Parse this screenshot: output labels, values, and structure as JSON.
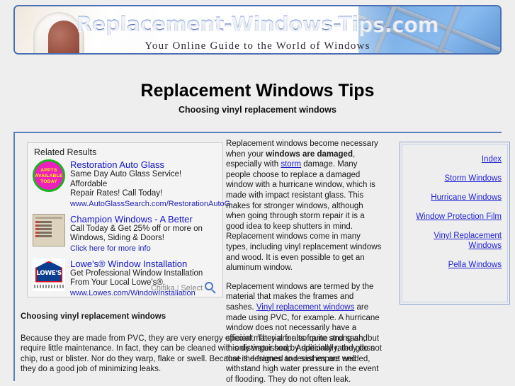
{
  "banner": {
    "title": "Replacement-Windows-Tips.com",
    "tagline": "Your Online Guide to the World of Windows",
    "border_color": "#4a6fb5"
  },
  "page": {
    "title": "Replacement Windows Tips",
    "subtitle": "Choosing vinyl replacement windows",
    "background": "#eeeeee"
  },
  "ads": {
    "heading": "Related Results",
    "items": [
      {
        "thumb": "appts-available-today-badge",
        "badge_line1": "APPTS",
        "badge_line2": "AVAILABLE",
        "badge_line3": "TODAY",
        "title": "Restoration Auto Glass",
        "desc_line1": "Same Day Auto Glass Service! Affordable",
        "desc_line2": "Repair Rates! Call Today!",
        "url": "www.AutoGlassSearch.com/RestorationAutoG"
      },
      {
        "thumb": "form-list-thumbnail",
        "title": "Champion Windows - A Better",
        "desc_line1": "Call Today & Get 25% off or more on",
        "desc_line2": "Windows, Siding & Doors!",
        "url": "Click here for more info"
      },
      {
        "thumb": "lowes-logo",
        "logo_text": "LOWE'S",
        "title": "Lowe's® Window Installation",
        "desc_line1": "Get Professional Window Installation",
        "desc_line2": "From Your Local Lowe's®.",
        "url": "www.Lowes.com/WindowInstallation"
      }
    ],
    "footer": {
      "brand": "Chitika",
      "separator": "|",
      "select": "Select",
      "icon": "magnifier-icon"
    }
  },
  "article": {
    "p1_a": "Replacement windows become necessary when your ",
    "p1_bold": "windows are damaged",
    "p1_b": ", especially with ",
    "p1_link": "storm",
    "p1_c": " damage. Many people choose to replace a damaged window with a hurricane window, which is made with impact resistant glass. This makes for stronger windows, although when going through storm repair it is a good idea to keep shutters in mind. Replacement windows come in many types, including vinyl replacement windows and wood. It is even possible to get an aluminum window.",
    "p2_a": "Replacement windows are termed by the material that makes the frames and sashes. ",
    "p2_link": "Vinyl replacement windows",
    "p2_b": " are made using PVC, for example. A hurricane window does not necessarily have a special material for its frame and sash, but it is distinguished by specially rated glass that is designed to resist impact and withstand high water pressure in the event of flooding. They do not often leak.",
    "subheading": "Choosing vinyl replacement windows",
    "p3": "Because they are made from PVC, they are very energy efficient. They are also quite strong and require little maintenance. In fact, they can be cleaned with only water soap. Additionally, they do not chip, rust or blister. Nor do they warp, flake or swell. Because the frames and sashes are welded, they do a good job of minimizing leaks."
  },
  "sidebar": {
    "links": [
      {
        "label": "Index"
      },
      {
        "label": "Storm Windows"
      },
      {
        "label": "Hurricane Windows"
      },
      {
        "label": "Window Protection Film"
      },
      {
        "label": "Vinyl Replacement Windows"
      },
      {
        "label": "Pella Windows"
      }
    ],
    "link_color": "#2424d8"
  }
}
